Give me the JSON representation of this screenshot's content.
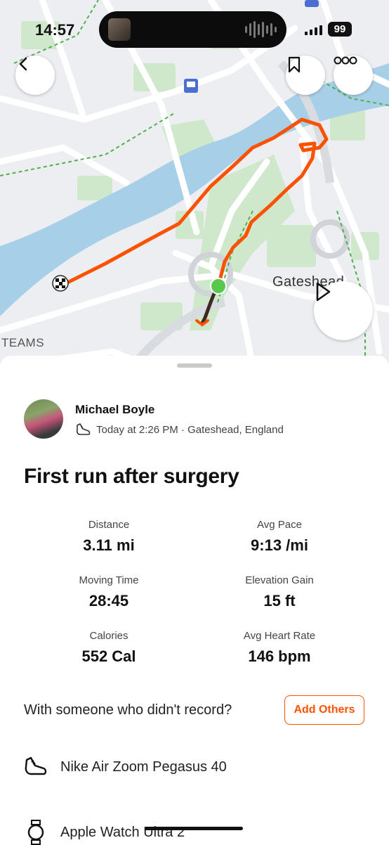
{
  "status_bar": {
    "time": "14:57",
    "battery": "99"
  },
  "map": {
    "place_label": "Gateshead",
    "corner_label": "TEAMS",
    "route_color": "#fc5200",
    "start_color": "#5ac84a"
  },
  "activity": {
    "athlete_name": "Michael Boyle",
    "meta": "Today at 2:26 PM · Gateshead, England",
    "title": "First run after surgery"
  },
  "stats": [
    {
      "label": "Distance",
      "value": "3.11 mi"
    },
    {
      "label": "Avg Pace",
      "value": "9:13 /mi"
    },
    {
      "label": "Moving Time",
      "value": "28:45"
    },
    {
      "label": "Elevation Gain",
      "value": "15 ft"
    },
    {
      "label": "Calories",
      "value": "552 Cal"
    },
    {
      "label": "Avg Heart Rate",
      "value": "146 bpm"
    }
  ],
  "others": {
    "question": "With someone who didn't record?",
    "button": "Add Others"
  },
  "gear": {
    "shoes": "Nike Air Zoom Pegasus 40",
    "device": "Apple Watch Ultra 2"
  },
  "icons": [
    "back-icon",
    "bookmark-icon",
    "more-icon",
    "play-icon",
    "shoe-icon",
    "watch-icon",
    "finish-flag-icon",
    "train-icon"
  ]
}
